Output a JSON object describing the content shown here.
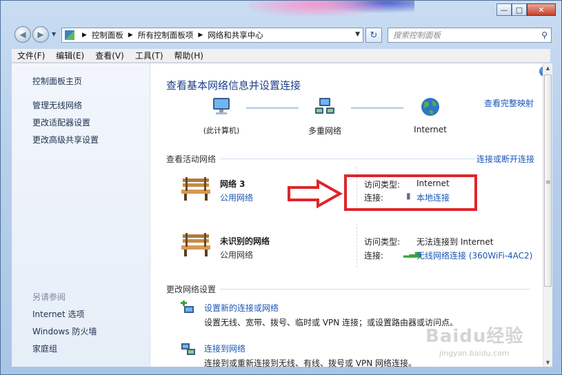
{
  "address_bar": {
    "crumbs": [
      "控制面板",
      "所有控制面板项",
      "网络和共享中心"
    ]
  },
  "search": {
    "placeholder": "搜索控制面板"
  },
  "menu": [
    "文件(F)",
    "编辑(E)",
    "查看(V)",
    "工具(T)",
    "帮助(H)"
  ],
  "sidebar": {
    "home": "控制面板主页",
    "items": [
      "管理无线网络",
      "更改适配器设置",
      "更改高级共享设置"
    ],
    "see_also_title": "另请参阅",
    "see_also": [
      "Internet 选项",
      "Windows 防火墙",
      "家庭组"
    ]
  },
  "main": {
    "heading": "查看基本网络信息并设置连接",
    "full_map_link": "查看完整映射",
    "map_nodes": {
      "this_pc": "(此计算机)",
      "multi": "多重网络",
      "internet": "Internet"
    },
    "active_section": "查看活动网络",
    "connect_disconnect": "连接或断开连接",
    "networks": [
      {
        "name": "网络  3",
        "type": "公用网络",
        "access_label": "访问类型:",
        "access_value": "Internet",
        "conn_label": "连接:",
        "conn_value": "本地连接"
      },
      {
        "name": "未识别的网络",
        "type": "公用网络",
        "access_label": "访问类型:",
        "access_value": "无法连接到 Internet",
        "conn_label": "连接:",
        "conn_value": "无线网络连接 (360WiFi-4AC2)"
      }
    ],
    "settings_section": "更改网络设置",
    "settings": [
      {
        "link": "设置新的连接或网络",
        "desc": "设置无线、宽带、拨号、临时或 VPN 连接；或设置路由器或访问点。"
      },
      {
        "link": "连接到网络",
        "desc": "连接到或重新连接到无线、有线、拨号或 VPN 网络连接。"
      }
    ]
  },
  "watermark": {
    "logo": "Baidu经验",
    "url": "jingyan.baidu.com"
  },
  "colors": {
    "link": "#1a56b4",
    "heading": "#1e3e8a",
    "highlight_box": "#e0242b"
  }
}
